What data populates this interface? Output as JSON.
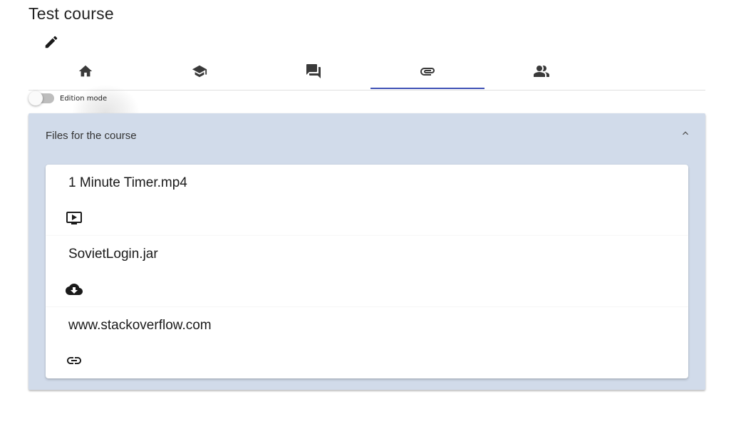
{
  "course": {
    "title": "Test course"
  },
  "toolbar": {
    "edit_icon": "pencil-icon"
  },
  "tabs": [
    {
      "icon": "home-icon",
      "active": false
    },
    {
      "icon": "school-icon",
      "active": false
    },
    {
      "icon": "forum-icon",
      "active": false
    },
    {
      "icon": "attachment-icon",
      "active": true
    },
    {
      "icon": "people-icon",
      "active": false
    }
  ],
  "edition_mode": {
    "label": "Edition mode",
    "enabled": false
  },
  "files_panel": {
    "title": "Files for the course",
    "expanded": true,
    "items": [
      {
        "name": "1 Minute Timer.mp4",
        "icon": "video-play-icon"
      },
      {
        "name": "SovietLogin.jar",
        "icon": "cloud-download-icon"
      },
      {
        "name": "www.stackoverflow.com",
        "icon": "link-icon"
      }
    ]
  },
  "colors": {
    "accent": "#3f51b5",
    "panel_background": "#d1dbea",
    "icon": "#3a3a3a"
  }
}
